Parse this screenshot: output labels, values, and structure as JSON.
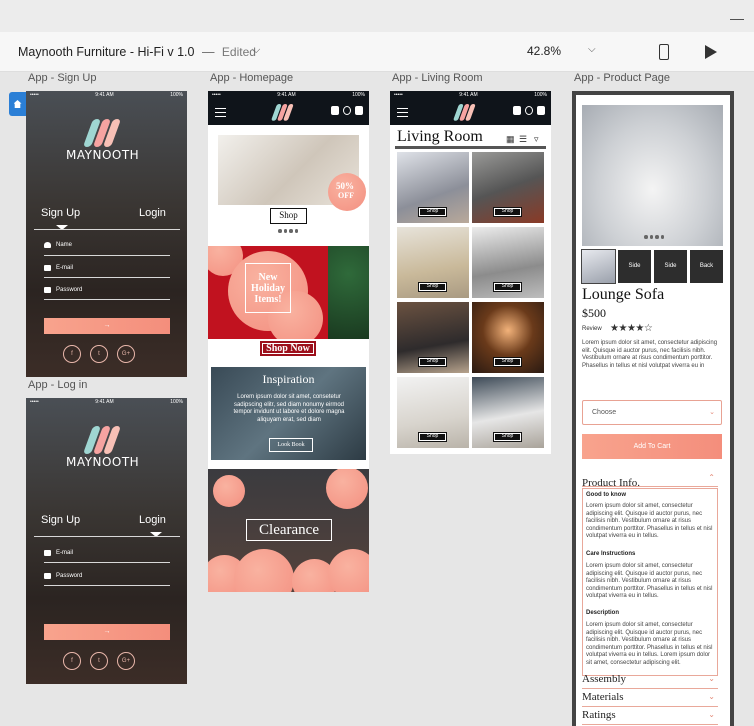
{
  "window": {
    "minimize_glyph": "—"
  },
  "app": {
    "doc_title": "Maynooth Furniture - Hi-Fi v 1.0",
    "separator": "—",
    "doc_status": "Edited",
    "zoom": "42.8%",
    "icons": [
      "chevron-down-icon",
      "phone-preview-icon",
      "play-icon",
      "home-icon"
    ]
  },
  "artboards": {
    "signup": "App - Sign Up",
    "homepage": "App - Homepage",
    "living_room": "App - Living Room",
    "product": "App - Product Page",
    "login": "App - Log in"
  },
  "status": {
    "carrier": "•••••",
    "time": "9:41 AM",
    "battery": "100%"
  },
  "auth": {
    "brand": "MAYNOOTH",
    "signup_tab": "Sign Up",
    "login_tab": "Login",
    "name_label": "Name",
    "email_label": "E-mail",
    "password_label": "Password",
    "submit_arrow": "→",
    "social": [
      "f",
      "t",
      "G+"
    ]
  },
  "home": {
    "promo_badge_pct": "50%",
    "promo_badge_off": "OFF",
    "shop_label": "Shop",
    "holiday_text": "New Holiday Items!",
    "shop_now": "Shop Now",
    "inspiration_title": "Inspiration",
    "inspiration_body": "Lorem ipsum dolor sit amet, consetetur sadipscing elitr, sed diam nonumy eirmod tempor invidunt ut labore et dolore magna aliquyam erat, sed diam",
    "look_book": "Look Book",
    "clearance": "Clearance"
  },
  "living": {
    "title": "Living Room",
    "tile_label": "Shop",
    "tiles": 8
  },
  "product": {
    "thumbs": [
      "Side",
      "Side",
      "Back"
    ],
    "name": "Lounge Sofa",
    "price": "$500",
    "review_label": "Review",
    "rating": 4,
    "rating_max": 5,
    "desc": "Lorem ipsum dolor sit amet, consectetur adipiscing elit. Quisque id auctor purus, nec facilisis nibh. Vestibulum ornare at risus condimentum porttitor. Phasellus in tellus et nisl volutpat viverra eu in",
    "choose": "Choose",
    "add_to_cart": "Add To Cart",
    "info_title": "Product Info.",
    "sections": [
      {
        "title": "Good to know",
        "body": "Lorem ipsum dolor sit amet, consectetur adipiscing elit. Quisque id auctor purus, nec facilisis nibh. Vestibulum ornare at risus condimentum porttitor. Phasellus in tellus et nisl volutpat viverra eu in tellus."
      },
      {
        "title": "Care Instructions",
        "body": "Lorem ipsum dolor sit amet, consectetur adipiscing elit. Quisque id auctor purus, nec facilisis nibh. Vestibulum ornare at risus condimentum porttitor. Phasellus in tellus et nisl volutpat viverra eu in tellus."
      },
      {
        "title": "Description",
        "body": "Lorem ipsum dolor sit amet, consectetur adipiscing elit. Quisque id auctor purus, nec facilisis nibh. Vestibulum ornare at risus condimentum porttitor. Phasellus in tellus et nisl volutpat viverra eu in tellus. Lorem ipsum dolor sit amet, consectetur adipiscing elit."
      }
    ],
    "accordions": [
      "Assembly",
      "Materials",
      "Ratings"
    ]
  },
  "colors": {
    "accent": "#f48e7c",
    "dark": "#0f141a",
    "holiday_red": "#c1121f",
    "select_blue": "#2b7fd6"
  }
}
